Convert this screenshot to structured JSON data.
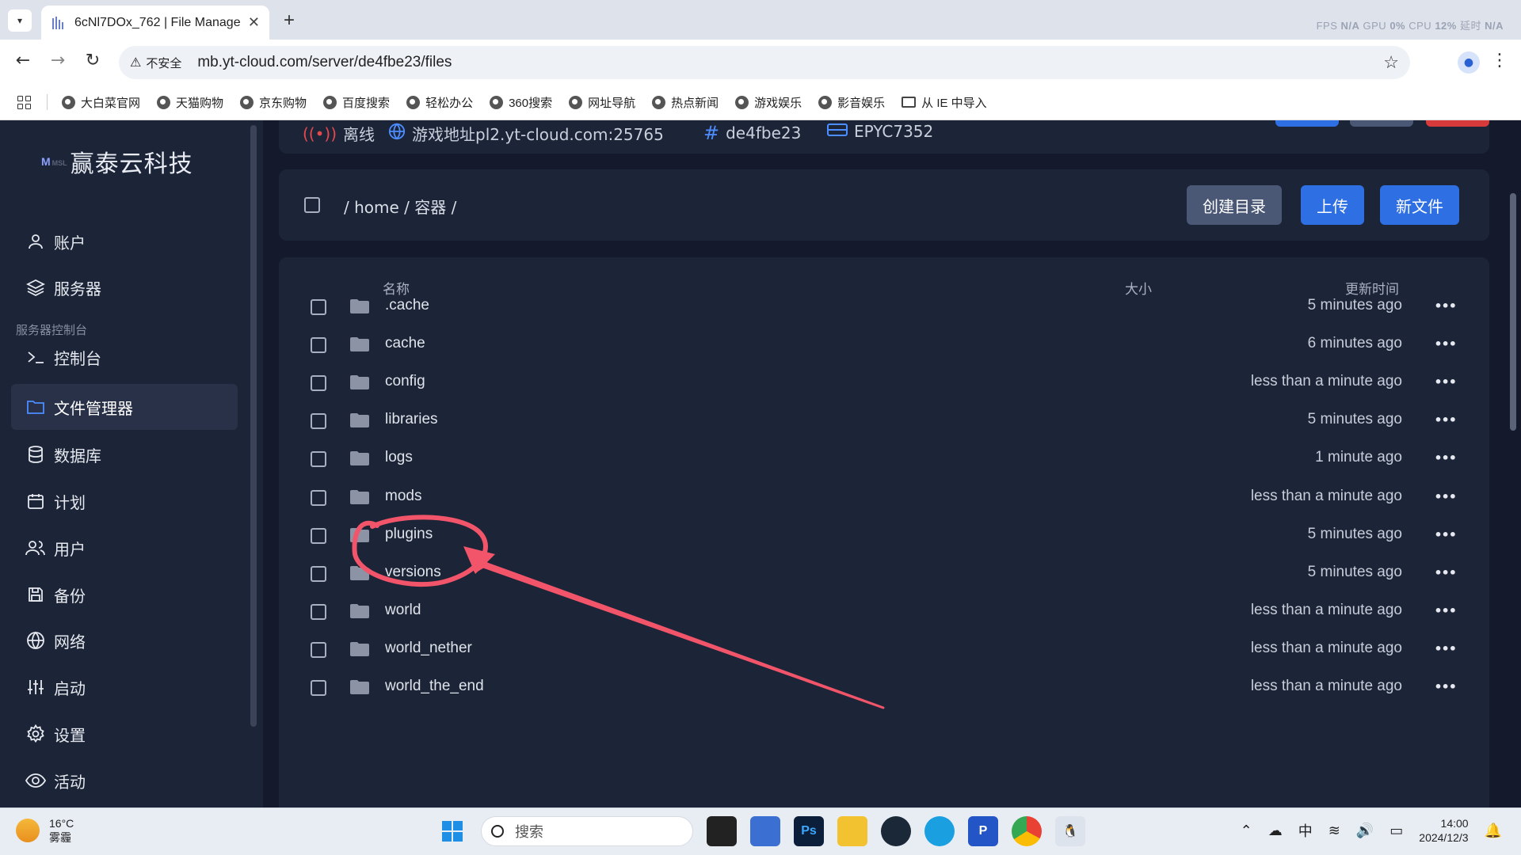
{
  "browser": {
    "tab_title": "6cNl7DOx_762 | File Manage",
    "overlay": [
      "FPS",
      "N/A",
      "GPU",
      "0%",
      "CPU",
      "12%",
      "延时",
      "N/A"
    ],
    "security_label": "不安全",
    "url": "mb.yt-cloud.com/server/de4fbe23/files",
    "bookmarks": [
      "大白菜官网",
      "天猫购物",
      "京东购物",
      "百度搜索",
      "轻松办公",
      "360搜索",
      "网址导航",
      "热点新闻",
      "游戏娱乐",
      "影音娱乐"
    ],
    "bookmark_folder": "从 IE 中导入"
  },
  "sidebar": {
    "brand": "赢泰云科技",
    "items_top": [
      "账户",
      "服务器"
    ],
    "section_label": "服务器控制台",
    "items": [
      "控制台",
      "文件管理器",
      "数据库",
      "计划",
      "用户",
      "备份",
      "网络",
      "启动",
      "设置",
      "活动"
    ],
    "active_index": 1
  },
  "server_bar": {
    "status": "离线",
    "address": "游戏地址pl2.yt-cloud.com:25765",
    "id": "de4fbe23",
    "cpu": "EPYC7352"
  },
  "path_bar": {
    "breadcrumb": "/ home / 容器 /",
    "buttons": {
      "create_dir": "创建目录",
      "upload": "上传",
      "new_file": "新文件"
    }
  },
  "file_table": {
    "headers": {
      "name": "名称",
      "size": "大小",
      "updated": "更新时间"
    },
    "rows": [
      {
        "name": ".cache",
        "updated": "5 minutes ago"
      },
      {
        "name": "cache",
        "updated": "6 minutes ago"
      },
      {
        "name": "config",
        "updated": "less than a minute ago"
      },
      {
        "name": "libraries",
        "updated": "5 minutes ago"
      },
      {
        "name": "logs",
        "updated": "1 minute ago"
      },
      {
        "name": "mods",
        "updated": "less than a minute ago"
      },
      {
        "name": "plugins",
        "updated": "5 minutes ago"
      },
      {
        "name": "versions",
        "updated": "5 minutes ago"
      },
      {
        "name": "world",
        "updated": "less than a minute ago"
      },
      {
        "name": "world_nether",
        "updated": "less than a minute ago"
      },
      {
        "name": "world_the_end",
        "updated": "less than a minute ago"
      }
    ],
    "more_label": "•••"
  },
  "taskbar": {
    "temperature": "16°C",
    "weather": "雾霾",
    "search_placeholder": "搜索",
    "ime": "中",
    "time": "14:00",
    "date": "2024/12/3"
  },
  "colors": {
    "accent_blue": "#2f6fe4",
    "secondary_btn": "#4a5775",
    "annotation": "#f2556a"
  }
}
